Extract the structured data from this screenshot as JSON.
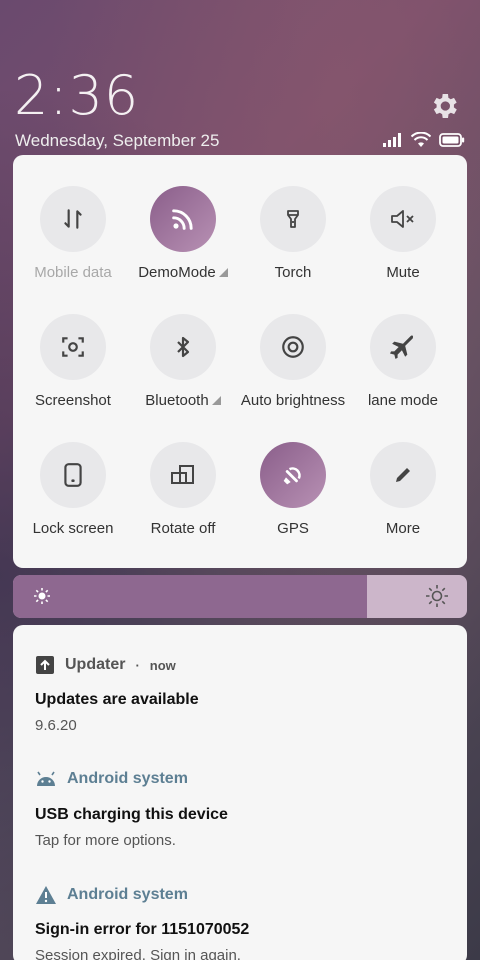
{
  "status": {
    "time": "2:36",
    "date": "Wednesday, September 25"
  },
  "quick_settings": {
    "tiles": [
      {
        "label": "Mobile data",
        "icon": "mobile-data-icon",
        "active": false,
        "disabled": true,
        "expandable": false
      },
      {
        "label": "DemoMode",
        "icon": "rss-icon",
        "active": true,
        "disabled": false,
        "expandable": true
      },
      {
        "label": "Torch",
        "icon": "torch-icon",
        "active": false,
        "disabled": false,
        "expandable": false
      },
      {
        "label": "Mute",
        "icon": "mute-icon",
        "active": false,
        "disabled": false,
        "expandable": false
      },
      {
        "label": "Screenshot",
        "icon": "screenshot-icon",
        "active": false,
        "disabled": false,
        "expandable": false
      },
      {
        "label": "Bluetooth",
        "icon": "bluetooth-icon",
        "active": false,
        "disabled": false,
        "expandable": true
      },
      {
        "label": "Auto brightness",
        "icon": "auto-brightness-icon",
        "active": false,
        "disabled": false,
        "expandable": false
      },
      {
        "label": "lane mode",
        "icon": "airplane-icon",
        "active": false,
        "disabled": false,
        "expandable": false
      },
      {
        "label": "Lock screen",
        "icon": "lock-screen-icon",
        "active": false,
        "disabled": false,
        "expandable": false
      },
      {
        "label": "Rotate off",
        "icon": "rotate-icon",
        "active": false,
        "disabled": false,
        "expandable": false
      },
      {
        "label": "GPS",
        "icon": "gps-icon",
        "active": true,
        "disabled": false,
        "expandable": false
      },
      {
        "label": "More",
        "icon": "edit-pencil-icon",
        "active": false,
        "disabled": false,
        "expandable": false
      }
    ]
  },
  "brightness": {
    "level": 0.78,
    "fill_color": "#8e6890",
    "track_color": "#ccb6ca"
  },
  "notifications": [
    {
      "app": "Updater",
      "time": "now",
      "title": "Updates are available",
      "body": "9.6.20",
      "icon": "upload-arrow-icon"
    },
    {
      "app": "Android system",
      "title": "USB charging this device",
      "body": "Tap for more options.",
      "icon": "android-icon"
    },
    {
      "app": "Android system",
      "title": "Sign-in error for 1151070052",
      "body": "Session expired. Sign in again.",
      "icon": "warning-icon"
    }
  ],
  "colors": {
    "accent": "#9a6f99",
    "teal_app": "#5d7f93"
  }
}
